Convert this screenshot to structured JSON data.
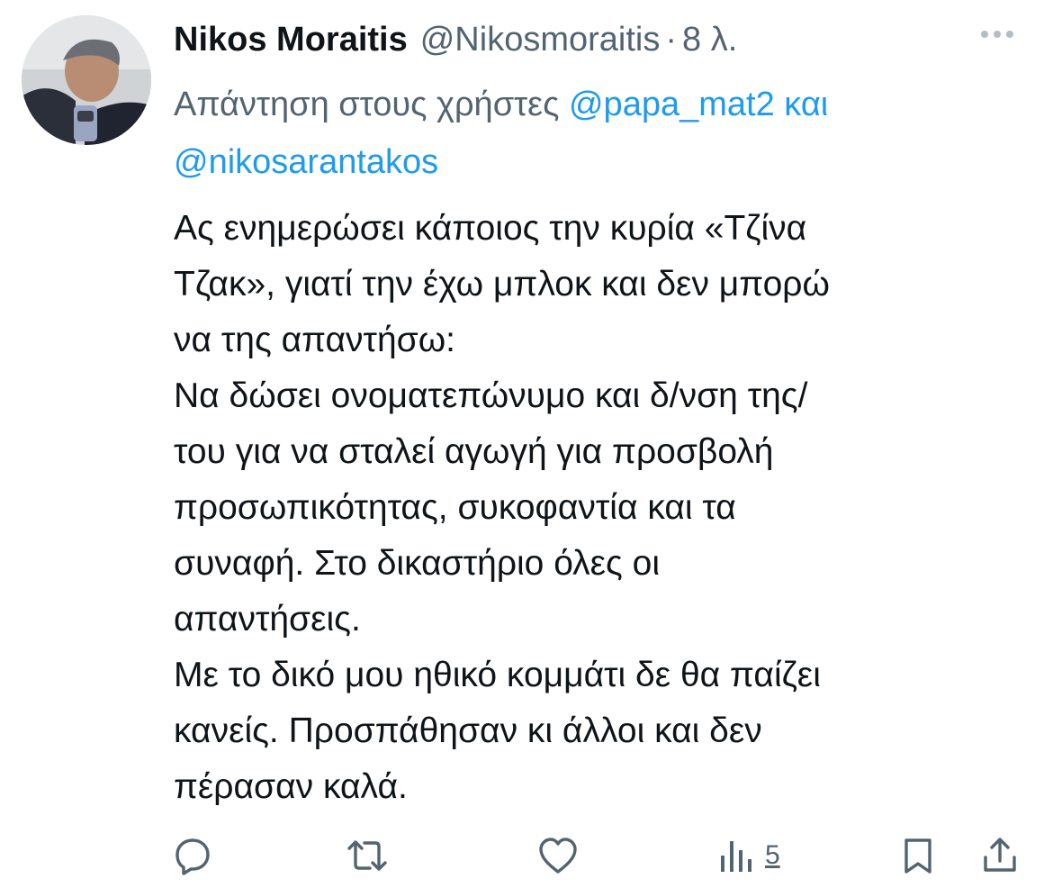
{
  "tweet": {
    "display_name": "Nikos Moraitis",
    "handle": "@Nikosmoraitis",
    "separator": "·",
    "time": "8 λ.",
    "reply_prefix": "Απάντηση στους χρήστες",
    "reply_mention_1": "@papa_mat2",
    "reply_conjunction": "και",
    "reply_mention_2": "@nikosarantakos",
    "body_lines": [
      "Ας ενημερώσει κάποιος την κυρία «Τζίνα",
      "Τζακ», γιατί την έχω μπλοκ και δεν μπορώ",
      "να της απαντήσω:",
      "Να δώσει ονοματεπώνυμο και δ/νση της/",
      "του για να σταλεί αγωγή για προσβολή",
      "προσωπικότητας, συκοφαντία και τα",
      "συναφή. Στο δικαστήριο όλες οι",
      "απαντήσεις.",
      "Με το δικό μου ηθικό κομμάτι δε θα παίζει",
      "κανείς. Προσπάθησαν κι άλλοι και δεν",
      "πέρασαν καλά."
    ]
  },
  "actions": {
    "views_count": "5"
  },
  "icons": {
    "more": "more-horizontal-icon",
    "reply": "reply-icon",
    "retweet": "retweet-icon",
    "like": "heart-icon",
    "views": "analytics-icon",
    "bookmark": "bookmark-icon",
    "share": "share-icon"
  },
  "colors": {
    "text": "#0f1419",
    "secondary": "#536471",
    "link": "#1d9bf0"
  }
}
